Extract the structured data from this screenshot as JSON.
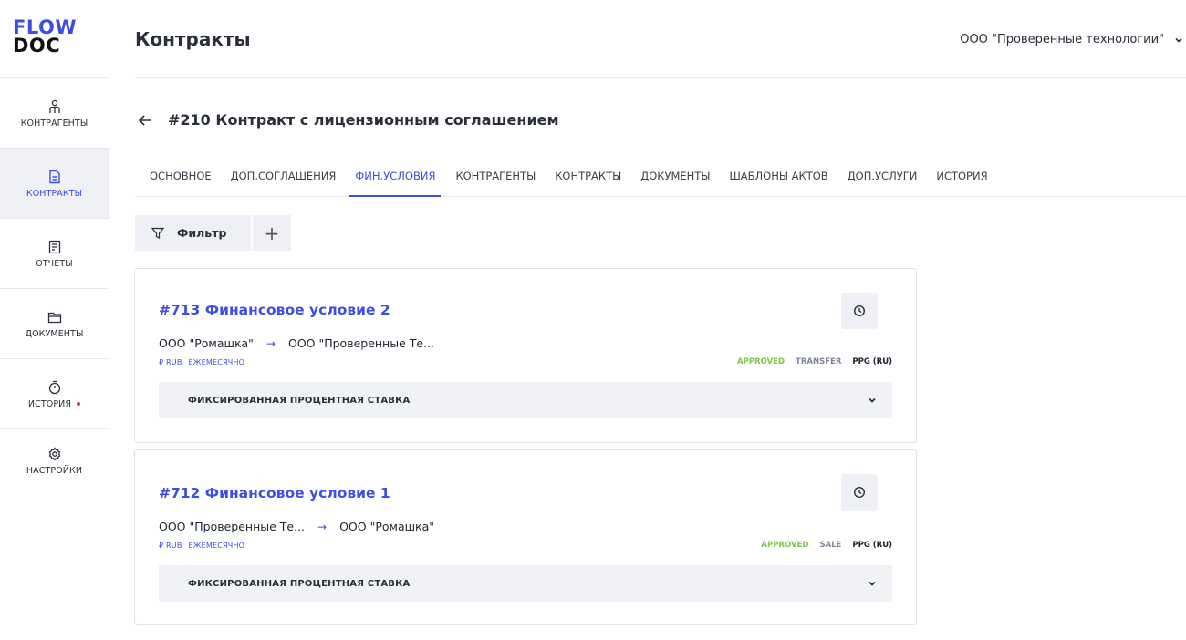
{
  "app": {
    "logo_line1": "FLOW",
    "logo_line2": "DOC",
    "brand_color": "#3d4fe0"
  },
  "sidebar": {
    "items": [
      {
        "label": "КОНТРАГЕНТЫ",
        "icon": "user-icon",
        "active": false
      },
      {
        "label": "КОНТРАКТЫ",
        "icon": "document-icon",
        "active": true
      },
      {
        "label": "ОТЧЕТЫ",
        "icon": "report-icon",
        "active": false
      },
      {
        "label": "ДОКУМЕНТЫ",
        "icon": "folder-icon",
        "active": false
      },
      {
        "label": "ИСТОРИЯ",
        "icon": "stopwatch-icon",
        "active": false,
        "has_notification": true
      },
      {
        "label": "НАСТРОЙКИ",
        "icon": "gear-icon",
        "active": false
      }
    ]
  },
  "header": {
    "title": "Контракты",
    "organization": "ООО \"Проверенные технологии\""
  },
  "contract": {
    "title": "#210 Контракт с лицензионным соглашением"
  },
  "tabs": [
    {
      "label": "ОСНОВНОЕ",
      "active": false
    },
    {
      "label": "ДОП.СОГЛАШЕНИЯ",
      "active": false
    },
    {
      "label": "ФИН.УСЛОВИЯ",
      "active": true
    },
    {
      "label": "КОНТРАГЕНТЫ",
      "active": false
    },
    {
      "label": "КОНТРАКТЫ",
      "active": false
    },
    {
      "label": "ДОКУМЕНТЫ",
      "active": false
    },
    {
      "label": "ШАБЛОНЫ АКТОВ",
      "active": false
    },
    {
      "label": "ДОП.УСЛУГИ",
      "active": false
    },
    {
      "label": "ИСТОРИЯ",
      "active": false
    }
  ],
  "toolbar": {
    "filter_label": "Фильтр",
    "add_label": "+"
  },
  "conditions": [
    {
      "title": "#713 Финансовое условие 2",
      "from": "ООО \"Ромашка\"",
      "arrow": "→",
      "to": "ООО \"Проверенные Те...",
      "currency": "₽ RUB",
      "period": "ЕЖЕМЕСЯЧНО",
      "status": "APPROVED",
      "type": "TRANSFER",
      "code": "PPG (RU)",
      "section": "ФИКСИРОВАННАЯ ПРОЦЕНТНАЯ СТАВКА"
    },
    {
      "title": "#712 Финансовое условие 1",
      "from": "ООО \"Проверенные Те...",
      "arrow": "→",
      "to": "ООО \"Ромашка\"",
      "currency": "₽ RUB",
      "period": "ЕЖЕМЕСЯЧНО",
      "status": "APPROVED",
      "type": "SALE",
      "code": "PPG (RU)",
      "section": "ФИКСИРОВАННАЯ ПРОЦЕНТНАЯ СТАВКА"
    }
  ],
  "colors": {
    "accent": "#3d4fe0",
    "status_approved": "#7ac943",
    "notification": "#e0334d"
  }
}
